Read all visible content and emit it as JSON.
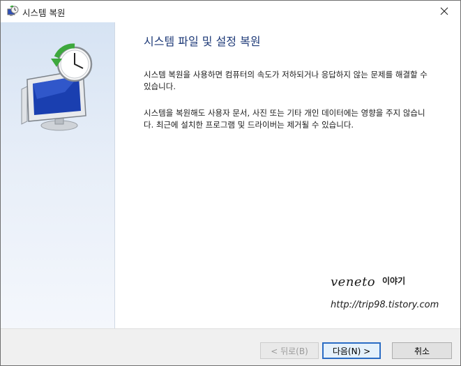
{
  "window": {
    "title": "시스템 복원"
  },
  "content": {
    "heading": "시스템 파일 및 설정 복원",
    "paragraph1": "시스템 복원을 사용하면 컴퓨터의 속도가 저하되거나 응답하지 않는 문제를 해결할 수 있습니다.",
    "paragraph2": "시스템을 복원해도 사용자 문서, 사진 또는 기타 개인 데이터에는 영향을 주지 않습니다. 최근에 설치한 프로그램 및 드라이버는 제거될 수 있습니다."
  },
  "watermark": {
    "brand": "veneto",
    "brand_sub": "이야기",
    "url": "http://trip98.tistory.com"
  },
  "buttons": {
    "back": "< 뒤로(B)",
    "next": "다음(N) >",
    "cancel": "취소"
  },
  "icons": {
    "title": "system-restore-icon",
    "close": "close-icon",
    "hero": "system-restore-monitor-clock-icon"
  },
  "colors": {
    "heading": "#1e3a78",
    "accent": "#2a6cc4",
    "side_panel_top": "#d6e3f3"
  }
}
